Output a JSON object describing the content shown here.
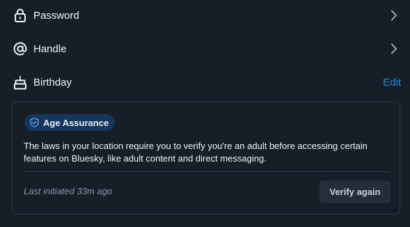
{
  "rows": [
    {
      "label": "Password",
      "icon": "lock-icon",
      "action": "chevron-right-icon"
    },
    {
      "label": "Handle",
      "icon": "at-sign-icon",
      "action": "chevron-right-icon"
    },
    {
      "label": "Birthday",
      "icon": "cake-icon",
      "action_label": "Edit"
    }
  ],
  "age_assurance": {
    "badge_label": "Age Assurance",
    "badge_icon": "shield-check-icon",
    "description": "The laws in your location require you to verify you're an adult before accessing certain features on Bluesky, like adult content and direct messaging.",
    "last_initiated": "Last initiated 33m ago",
    "verify_button_label": "Verify again"
  },
  "colors": {
    "background": "#161e27",
    "text": "#f1f3f5",
    "accent_link": "#1d8af0",
    "badge_bg": "#16365c",
    "badge_icon": "#5a9cf0",
    "muted_text": "#8a96a3",
    "card_border": "#2e3a48",
    "button_bg": "#232e3a"
  }
}
